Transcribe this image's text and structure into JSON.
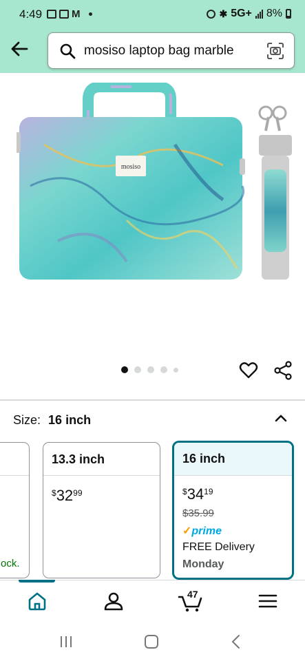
{
  "status_bar": {
    "time": "4:49",
    "network": "5G+",
    "battery": "8%"
  },
  "search": {
    "query": "mosiso laptop bag marble"
  },
  "product": {
    "brand_tag": "mosiso",
    "carousel": {
      "count": 5,
      "active_index": 0
    }
  },
  "size_selector": {
    "label": "Size:",
    "selected": "16 inch",
    "options": [
      {
        "name": "",
        "availability": "ock."
      },
      {
        "name": "13.3 inch",
        "price_whole": "32",
        "price_fraction": "99",
        "currency": "$"
      },
      {
        "name": "16 inch",
        "price_whole": "34",
        "price_fraction": "19",
        "currency": "$",
        "list_price": "$35.99",
        "prime": "prime",
        "delivery": "FREE Delivery",
        "delivery_day": "Monday",
        "selected": true
      }
    ]
  },
  "bottom_nav": {
    "cart_count": "47",
    "active": "home"
  },
  "colors": {
    "header": "#a6e7ce",
    "accent": "#007185",
    "selected_bg": "#eaf8fb",
    "prime": "#00a8e1",
    "in_stock": "#007600"
  }
}
